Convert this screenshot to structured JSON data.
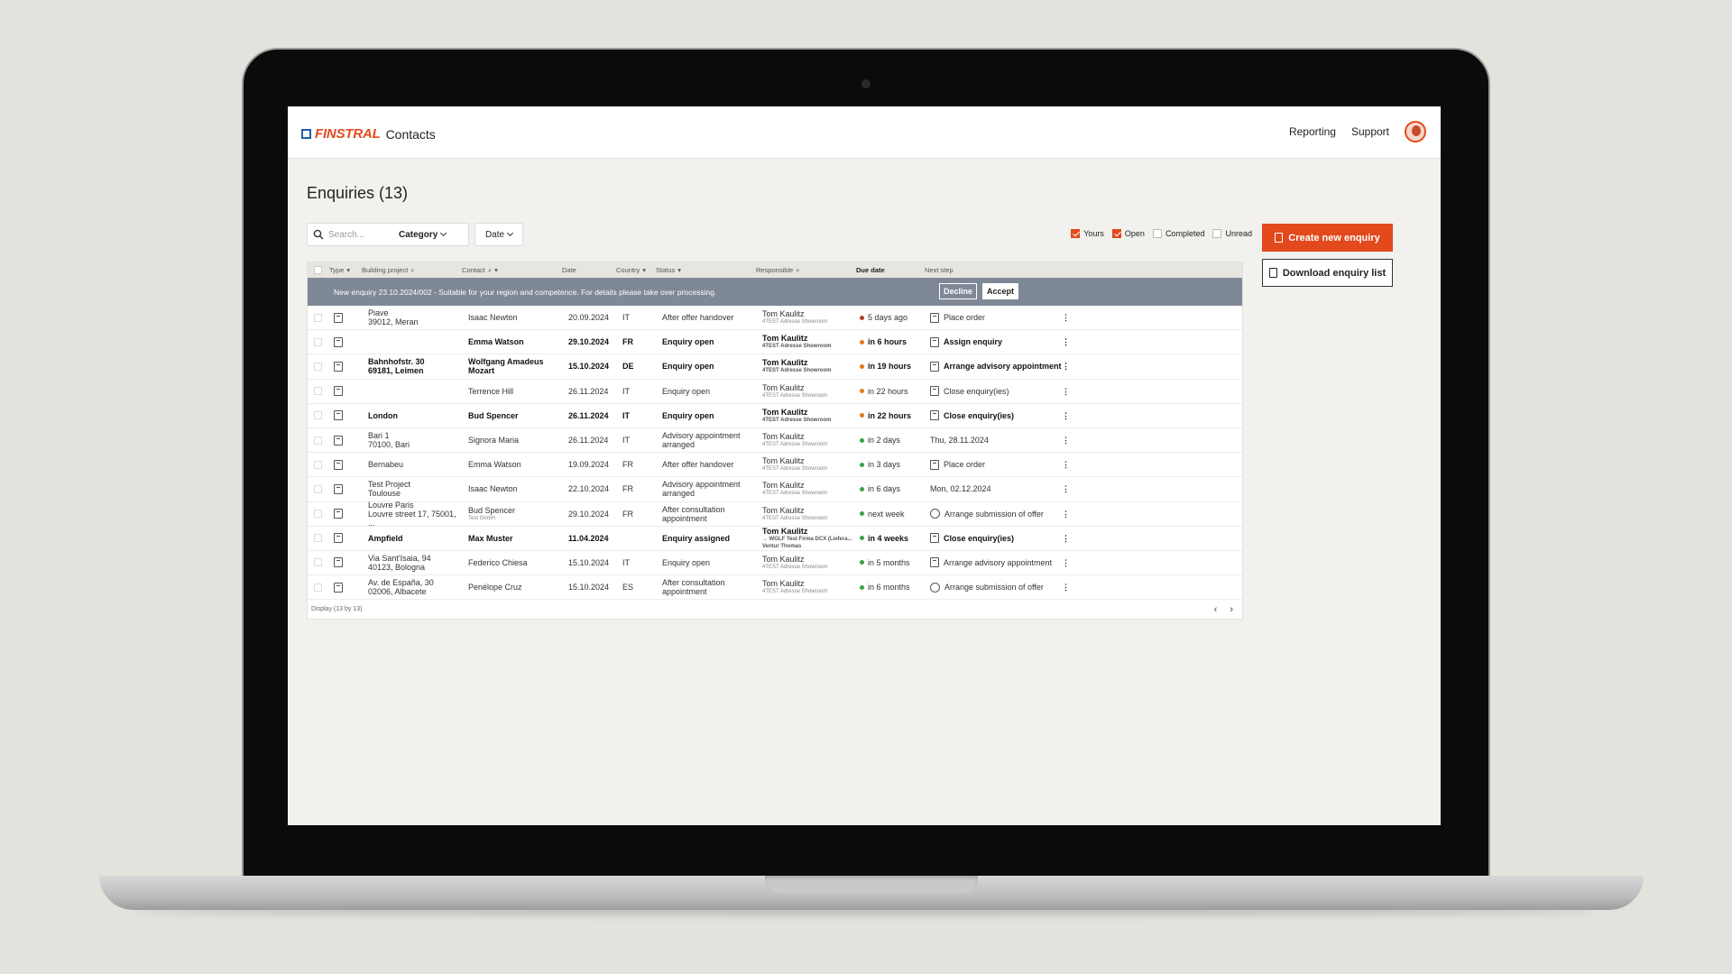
{
  "app": {
    "brand": "FINSTRAL",
    "name": "Contacts"
  },
  "nav": {
    "reporting": "Reporting",
    "support": "Support"
  },
  "page": {
    "title": "Enquiries (13)"
  },
  "filters": {
    "search_placeholder": "Search...",
    "category_label": "Category",
    "date_label": "Date",
    "checks": [
      {
        "label": "Yours",
        "checked": true
      },
      {
        "label": "Open",
        "checked": true
      },
      {
        "label": "Completed",
        "checked": false
      },
      {
        "label": "Unread",
        "checked": false
      }
    ]
  },
  "actions": {
    "create": "Create new enquiry",
    "download": "Download enquiry list"
  },
  "table": {
    "headers": [
      "Type",
      "Building project",
      "Contact",
      "Date",
      "Country",
      "Status",
      "Responsible",
      "Due date",
      "Next step"
    ],
    "banner": {
      "text": "New enquiry 23.10.2024/002 - Suitable for your region and competence. For details please take over processing.",
      "decline": "Decline",
      "accept": "Accept"
    },
    "rows": [
      {
        "bold": false,
        "type_icon": "door-icon",
        "project": "Piave\n39012, Meran",
        "contact": "Isaac Newton",
        "contact_sub": "",
        "date": "20.09.2024",
        "country": "IT",
        "status": "After offer handover",
        "resp": "Tom Kaulitz",
        "resp_sub": "4TEST Adresse Showroom",
        "due_color": "#b0422a",
        "due": "5 days ago",
        "next_icon": "document-icon",
        "next": "Place order"
      },
      {
        "bold": true,
        "type_icon": "people-icon",
        "project": "",
        "contact": "Emma Watson",
        "contact_sub": "",
        "date": "29.10.2024",
        "country": "FR",
        "status": "Enquiry open",
        "resp": "Tom Kaulitz",
        "resp_sub": "4TEST Adresse Showroom",
        "due_color": "#e07a1f",
        "due": "in 6 hours",
        "next_icon": "document-icon",
        "next": "Assign enquiry"
      },
      {
        "bold": true,
        "type_icon": "door-icon",
        "project": "Bahnhofstr. 30\n69181, Leimen",
        "contact": "Wolfgang Amadeus\nMozart",
        "contact_sub": "",
        "date": "15.10.2024",
        "country": "DE",
        "status": "Enquiry open",
        "resp": "Tom Kaulitz",
        "resp_sub": "4TEST Adresse Showroom",
        "due_color": "#e07a1f",
        "due": "in 19 hours",
        "next_icon": "document-icon",
        "next": "Arrange advisory appointment"
      },
      {
        "bold": false,
        "type_icon": "inbox-icon",
        "project": "",
        "contact": "Terrence Hill",
        "contact_sub": "",
        "date": "26.11.2024",
        "country": "IT",
        "status": "Enquiry open",
        "resp": "Tom Kaulitz",
        "resp_sub": "4TEST Adresse Showroom",
        "due_color": "#e07a1f",
        "due": "in 22 hours",
        "next_icon": "document-icon",
        "next": "Close enquiry(ies)"
      },
      {
        "bold": true,
        "type_icon": "form-icon",
        "project": "London",
        "contact": "Bud Spencer",
        "contact_sub": "",
        "date": "26.11.2024",
        "country": "IT",
        "status": "Enquiry open",
        "resp": "Tom Kaulitz",
        "resp_sub": "4TEST Adresse Showroom",
        "due_color": "#e07a1f",
        "due": "in 22 hours",
        "next_icon": "document-icon",
        "next": "Close enquiry(ies)"
      },
      {
        "bold": false,
        "type_icon": "door-icon",
        "project": "Bari 1\n70100, Bari",
        "contact": "Signora Maria",
        "contact_sub": "",
        "date": "26.11.2024",
        "country": "IT",
        "status": "Advisory appointment\narranged",
        "resp": "Tom Kaulitz",
        "resp_sub": "4TEST Adresse Showroom",
        "due_color": "#3aa346",
        "due": "in 2 days",
        "next_icon": "",
        "next": "Thu, 28.11.2024"
      },
      {
        "bold": false,
        "type_icon": "door-icon",
        "project": "Bernabeu",
        "contact": "Emma Watson",
        "contact_sub": "",
        "date": "19.09.2024",
        "country": "FR",
        "status": "After offer handover",
        "resp": "Tom Kaulitz",
        "resp_sub": "4TEST Adresse Showroom",
        "due_color": "#3aa346",
        "due": "in 3 days",
        "next_icon": "document-icon",
        "next": "Place order"
      },
      {
        "bold": false,
        "type_icon": "door-icon",
        "project": "Test Project\nToulouse",
        "contact": "Isaac Newton",
        "contact_sub": "",
        "date": "22.10.2024",
        "country": "FR",
        "status": "Advisory appointment\narranged",
        "resp": "Tom Kaulitz",
        "resp_sub": "4TEST Adresse Showroom",
        "due_color": "#3aa346",
        "due": "in 6 days",
        "next_icon": "",
        "next": "Mon, 02.12.2024"
      },
      {
        "bold": false,
        "type_icon": "door-icon",
        "project": "Louvre Paris\nLouvre street 17, 75001, ...",
        "contact": "Bud Spencer",
        "contact_sub": "Test GmbH",
        "date": "29.10.2024",
        "country": "FR",
        "status": "After consultation\nappointment",
        "resp": "Tom Kaulitz",
        "resp_sub": "4TEST Adresse Showroom",
        "due_color": "#3aa346",
        "due": "next week",
        "next_icon": "gear-icon",
        "next": "Arrange submission of offer"
      },
      {
        "bold": true,
        "type_icon": "pencil-icon",
        "project": "Ampfield",
        "contact": "Max Muster",
        "contact_sub": "",
        "date": "11.04.2024",
        "country": "",
        "status": "Enquiry assigned",
        "resp": "Tom Kaulitz",
        "resp_sub": "→ WGLF Test Firma DCX (Liefera...\nVentur Thomas",
        "due_color": "#3aa346",
        "due": "in 4 weeks",
        "next_icon": "document-icon",
        "next": "Close enquiry(ies)"
      },
      {
        "bold": false,
        "type_icon": "door-icon",
        "project": "Via Sant'Isaia, 94\n40123, Bologna",
        "contact": "Federico Chiesa",
        "contact_sub": "",
        "date": "15.10.2024",
        "country": "IT",
        "status": "Enquiry open",
        "resp": "Tom Kaulitz",
        "resp_sub": "4TEST Adresse Showroom",
        "due_color": "#3aa346",
        "due": "in 5 months",
        "next_icon": "document-icon",
        "next": "Arrange advisory appointment"
      },
      {
        "bold": false,
        "type_icon": "door-icon",
        "project": "Av. de España, 30\n02006, Albacete",
        "contact": "Penélope Cruz",
        "contact_sub": "",
        "date": "15.10.2024",
        "country": "ES",
        "status": "After consultation\nappointment",
        "resp": "Tom Kaulitz",
        "resp_sub": "4TEST Adresse Showroom",
        "due_color": "#3aa346",
        "due": "in 6 months",
        "next_icon": "gear-icon",
        "next": "Arrange submission of offer"
      }
    ],
    "footer": "Display  (13 by 13)"
  }
}
